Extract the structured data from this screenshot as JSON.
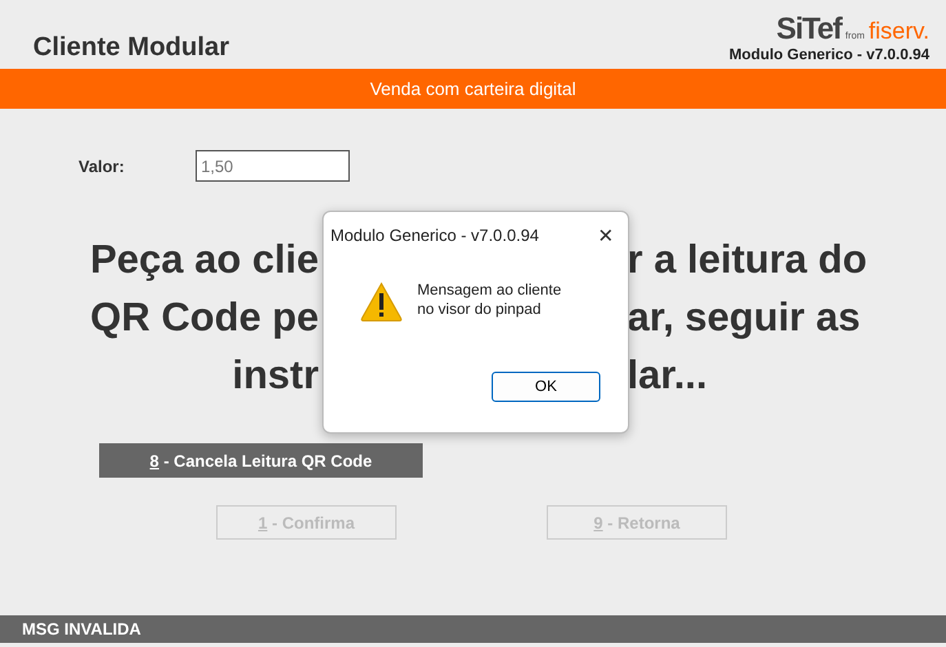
{
  "header": {
    "title": "Cliente Modular",
    "brand": "SiTef",
    "brand_from": "from",
    "brand_partner": "fiserv.",
    "version": "Modulo Generico - v7.0.0.94"
  },
  "banner": "Venda com carteira digital",
  "amount": {
    "label": "Valor:",
    "value": "1,50"
  },
  "message_lines": [
    {
      "left": "Peça ao clie",
      "right": "r a leitura do"
    },
    {
      "left": "QR Code pe",
      "right": "ar, seguir as"
    },
    {
      "left": "instr",
      "right": "lar..."
    }
  ],
  "actions": [
    {
      "key": "8",
      "label": " - Cancela Leitura QR Code",
      "disabled": false
    }
  ],
  "buttons": [
    {
      "key": "1",
      "label": " - Confirma",
      "disabled": true
    },
    {
      "key": "9",
      "label": " - Retorna",
      "disabled": true
    }
  ],
  "dialog": {
    "title": "Modulo Generico - v7.0.0.94",
    "close": "✕",
    "lines": [
      "Mensagem ao cliente",
      "no visor do pinpad"
    ],
    "ok": "OK"
  },
  "status_bar": "MSG INVALIDA"
}
